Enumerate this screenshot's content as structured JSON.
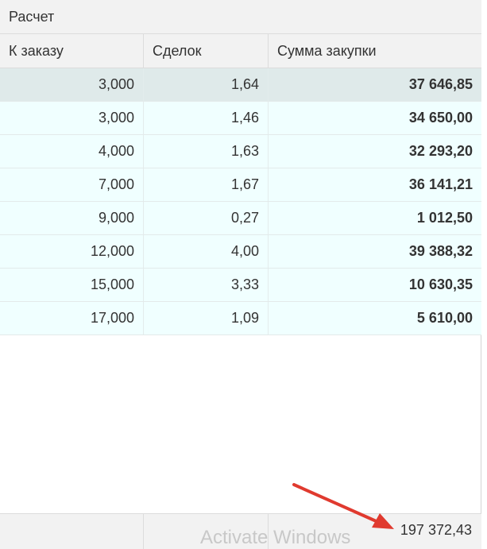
{
  "panel": {
    "title": "Расчет"
  },
  "grid": {
    "columns": [
      "К заказу",
      "Сделок",
      "Сумма закупки"
    ],
    "rows": [
      {
        "to_order": "3,000",
        "deals": "1,64",
        "purchase_sum": "37 646,85",
        "selected": true
      },
      {
        "to_order": "3,000",
        "deals": "1,46",
        "purchase_sum": "34 650,00"
      },
      {
        "to_order": "4,000",
        "deals": "1,63",
        "purchase_sum": "32 293,20"
      },
      {
        "to_order": "7,000",
        "deals": "1,67",
        "purchase_sum": "36 141,21"
      },
      {
        "to_order": "9,000",
        "deals": "0,27",
        "purchase_sum": "1 012,50"
      },
      {
        "to_order": "12,000",
        "deals": "4,00",
        "purchase_sum": "39 388,32"
      },
      {
        "to_order": "15,000",
        "deals": "3,33",
        "purchase_sum": "10 630,35"
      },
      {
        "to_order": "17,000",
        "deals": "1,09",
        "purchase_sum": "5 610,00"
      }
    ],
    "footer": {
      "purchase_sum_total": "197 372,43"
    }
  },
  "watermark": "Activate Windows",
  "colors": {
    "row_background": "#f0ffff",
    "selected_row_background": "#dfeaea",
    "header_background": "#f2f2f2",
    "annotation_arrow": "#e03a2f"
  },
  "annotation": {
    "icon": "arrow-icon"
  }
}
